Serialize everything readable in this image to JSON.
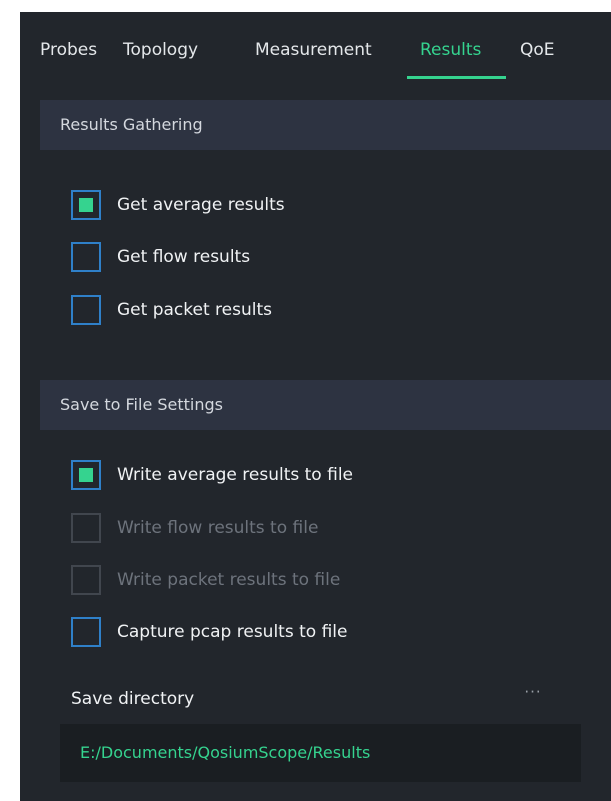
{
  "tabs": {
    "probes": "Probes",
    "topology": "Topology",
    "measurement": "Measurement",
    "results": "Results",
    "qoe": "QoE",
    "active": "Results"
  },
  "results_gathering": {
    "header": "Results Gathering",
    "options": [
      {
        "label": "Get average results",
        "checked": true,
        "enabled": true
      },
      {
        "label": "Get flow results",
        "checked": false,
        "enabled": true
      },
      {
        "label": "Get packet results",
        "checked": false,
        "enabled": true
      }
    ]
  },
  "save_settings": {
    "header": "Save to File Settings",
    "options": [
      {
        "label": "Write average results to file",
        "checked": true,
        "enabled": true
      },
      {
        "label": "Write flow results to file",
        "checked": false,
        "enabled": false
      },
      {
        "label": "Write packet results to file",
        "checked": false,
        "enabled": false
      },
      {
        "label": "Capture pcap results to file",
        "checked": false,
        "enabled": true
      }
    ],
    "directory_label": "Save directory",
    "browse_label": "···",
    "directory_value": "E:/Documents/QosiumScope/Results"
  },
  "colors": {
    "background": "#22262c",
    "section_header": "#2d3341",
    "accent": "#35d38f",
    "checkbox_border": "#2f80c9",
    "disabled_text": "#6d737c",
    "field_background": "#1a1e22"
  }
}
